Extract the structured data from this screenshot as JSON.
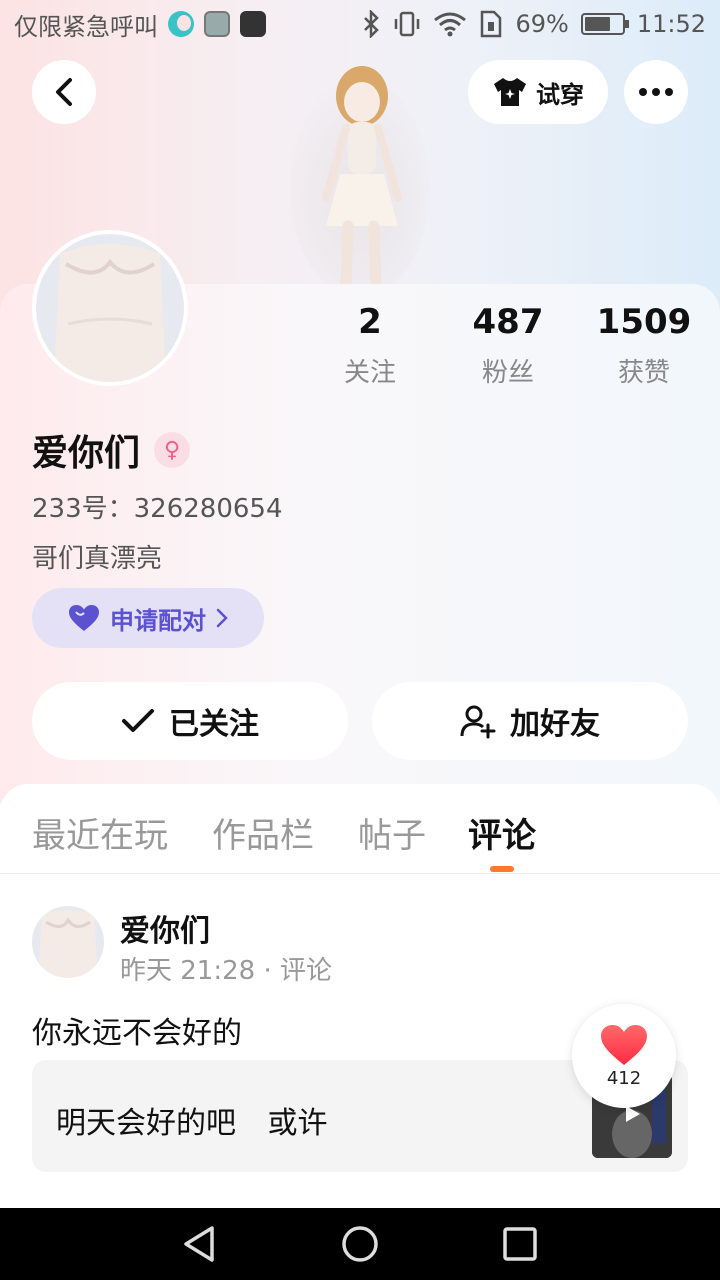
{
  "status_bar": {
    "carrier_text": "仅限紧急呼叫",
    "battery": "69%",
    "battery_level": 0.69,
    "time": "11:52",
    "icons": [
      "moon-icon",
      "image-icon",
      "app-icon",
      "bluetooth-icon",
      "vibrate-icon",
      "wifi-icon",
      "sim-icon",
      "battery-icon"
    ]
  },
  "header": {
    "try_on_label": "试穿"
  },
  "stats": [
    {
      "value": "2",
      "label": "关注"
    },
    {
      "value": "487",
      "label": "粉丝"
    },
    {
      "value": "1509",
      "label": "获赞"
    }
  ],
  "profile": {
    "username": "爱你们",
    "gender_icon": "female-icon",
    "user_id": "233号：326280654",
    "bio": "哥们真漂亮",
    "pair_label": "申请配对"
  },
  "actions": {
    "follow_label": "已关注",
    "add_friend_label": "加好友"
  },
  "tabs": [
    {
      "label": "最近在玩",
      "active": false
    },
    {
      "label": "作品栏",
      "active": false
    },
    {
      "label": "帖子",
      "active": false
    },
    {
      "label": "评论",
      "active": true
    }
  ],
  "comment": {
    "author": "爱你们",
    "meta": "昨天 21:28 · 评论",
    "text": "你永远不会好的",
    "quoted_text": "明天会好的吧 或许",
    "like_count": "412"
  },
  "colors": {
    "accent": "#ff7a2e",
    "pair": "#5b52cf",
    "like": "#ff3b4d"
  }
}
